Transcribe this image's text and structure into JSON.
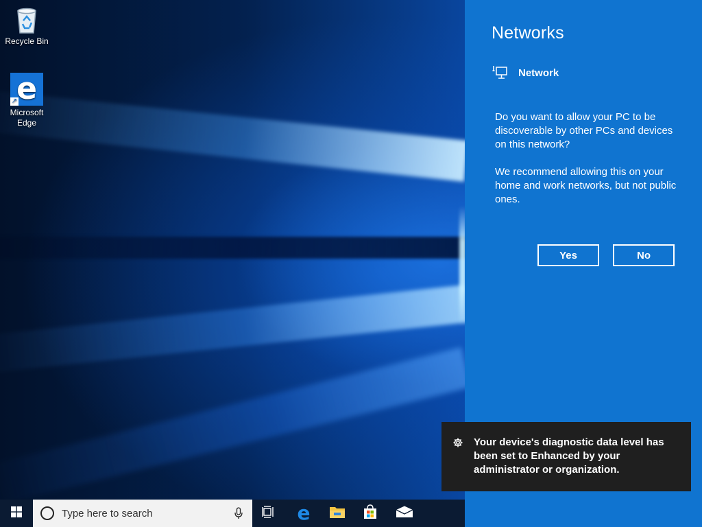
{
  "desktop": {
    "icons": [
      {
        "label": "Recycle Bin",
        "icon": "recycle-bin-icon"
      },
      {
        "label": "Microsoft Edge",
        "icon": "edge-icon"
      }
    ]
  },
  "flyout": {
    "title": "Networks",
    "network_name": "Network",
    "network_icon": "wired-network-icon",
    "question": "Do you want to allow your PC to be discoverable by other PCs and devices on this network?",
    "recommendation": "We recommend allowing this on your home and work networks, but not public ones.",
    "yes_label": "Yes",
    "no_label": "No",
    "accent_color": "#1074d0"
  },
  "toast": {
    "icon": "gear-icon",
    "message": "Your device's diagnostic data level has been set to Enhanced by your administrator or organization."
  },
  "taskbar": {
    "start_icon": "windows-start-icon",
    "search_placeholder": "Type here to search",
    "pinned": [
      {
        "name": "task-view",
        "icon": "task-view-icon"
      },
      {
        "name": "edge",
        "icon": "edge-icon"
      },
      {
        "name": "file-explorer",
        "icon": "folder-icon"
      },
      {
        "name": "store",
        "icon": "store-icon"
      },
      {
        "name": "mail",
        "icon": "mail-icon"
      }
    ]
  }
}
